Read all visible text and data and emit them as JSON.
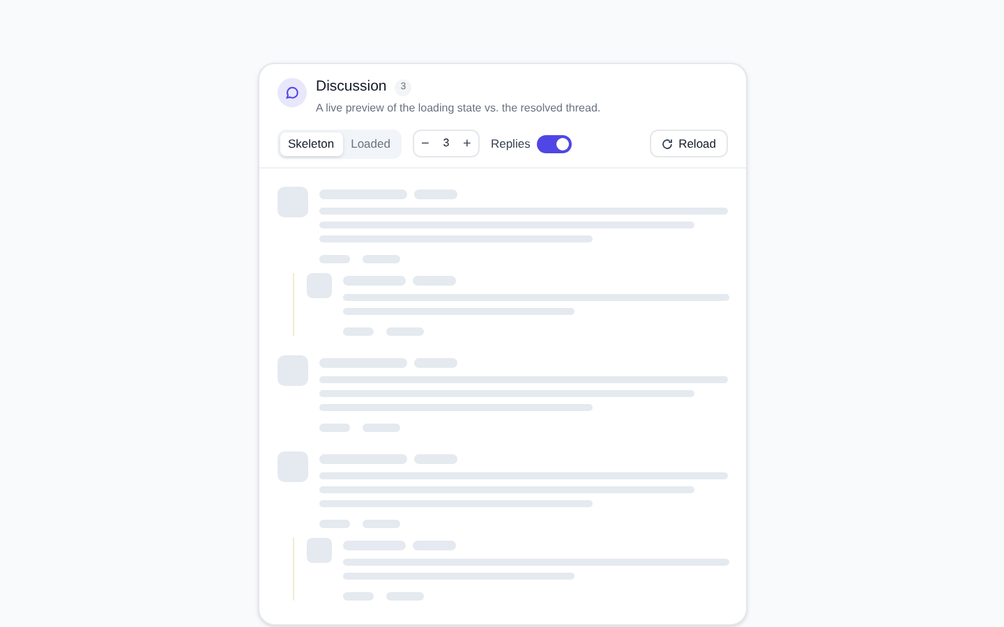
{
  "header": {
    "title": "Discussion",
    "count": "3",
    "subtitle": "A live preview of the loading state vs. the resolved thread."
  },
  "view_tabs": [
    {
      "label": "Skeleton",
      "selected": true
    },
    {
      "label": "Loaded",
      "selected": false
    }
  ],
  "stepper": {
    "decrement": "−",
    "value": "3",
    "increment": "+"
  },
  "replies_toggle": {
    "label": "Replies",
    "on": true
  },
  "reload_button": {
    "label": "Reload"
  },
  "skeleton": [
    {
      "kind": "comment",
      "children": [
        {
          "kind": "reply"
        }
      ]
    },
    {
      "kind": "comment"
    },
    {
      "kind": "comment",
      "children": [
        {
          "kind": "reply"
        }
      ]
    }
  ]
}
